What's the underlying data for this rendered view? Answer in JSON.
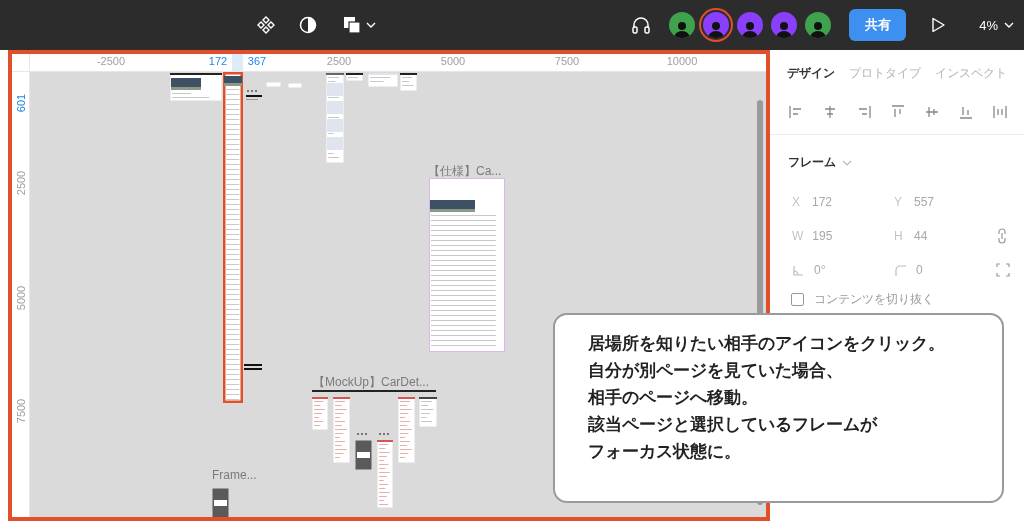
{
  "toolbar": {
    "avatars": [
      {
        "color": "#3fa34d",
        "selected": false
      },
      {
        "color": "#8a3ffc",
        "selected": true
      },
      {
        "color": "#8a3ffc",
        "selected": false
      },
      {
        "color": "#8a3ffc",
        "selected": false
      },
      {
        "color": "#3fa34d",
        "selected": false
      }
    ],
    "share_button": "共有",
    "zoom": "4%"
  },
  "canvas": {
    "ruler_top": [
      {
        "label": "-2500",
        "highlighted": false
      },
      {
        "label": "172",
        "highlighted": true
      },
      {
        "label": "367",
        "highlighted": true
      },
      {
        "label": "2500",
        "highlighted": false
      },
      {
        "label": "5000",
        "highlighted": false
      },
      {
        "label": "7500",
        "highlighted": false
      },
      {
        "label": "10000",
        "highlighted": false
      }
    ],
    "ruler_left": [
      {
        "label": "601",
        "highlighted": true
      },
      {
        "label": "2500",
        "highlighted": false
      },
      {
        "label": "5000",
        "highlighted": false
      },
      {
        "label": "7500",
        "highlighted": false
      }
    ],
    "frame_labels": [
      "【仕様】Ca...",
      "【MockUp】CarDet...",
      "Frame..."
    ]
  },
  "panel": {
    "tabs": [
      {
        "label": "デザイン",
        "selected": true
      },
      {
        "label": "プロトタイプ",
        "selected": false
      },
      {
        "label": "インスペクト",
        "selected": false
      }
    ],
    "section": "フレーム",
    "fields": [
      {
        "kind": "text",
        "label": "X",
        "value": "172"
      },
      {
        "kind": "text",
        "label": "Y",
        "value": "557"
      },
      {
        "kind": "text",
        "label": "W",
        "value": "195"
      },
      {
        "kind": "text",
        "label": "H",
        "value": "44"
      },
      {
        "kind": "rotation",
        "value": "0°"
      },
      {
        "kind": "radius",
        "value": "0"
      }
    ],
    "clip_content": {
      "label": "コンテンツを切り抜く",
      "checked": false
    }
  },
  "callout": {
    "lines": [
      "居場所を知りたい相手のアイコンをクリック。",
      "自分が別ページを見ていた場合、",
      "相手のページへ移動。",
      "該当ページと選択しているフレームが",
      "フォーカス状態に。"
    ]
  }
}
